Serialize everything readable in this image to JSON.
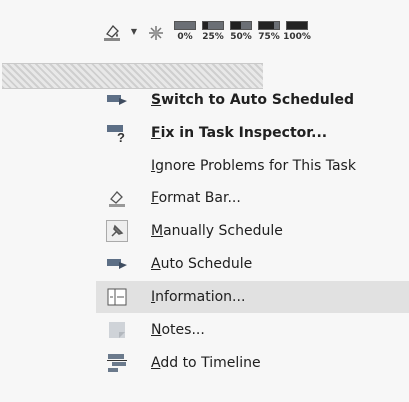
{
  "toolbar": {
    "tools": [
      {
        "name": "highlight-color-icon"
      },
      {
        "name": "dropdown-arrow-icon"
      },
      {
        "name": "task-status-icon"
      }
    ],
    "percent_buttons": [
      {
        "label": "0%",
        "value": 0
      },
      {
        "label": "25%",
        "value": 25
      },
      {
        "label": "50%",
        "value": 50
      },
      {
        "label": "75%",
        "value": 75
      },
      {
        "label": "100%",
        "value": 100
      }
    ]
  },
  "menu": {
    "items": [
      {
        "label": "Switch to Auto Scheduled",
        "icon": "auto-schedule-icon",
        "bold": true
      },
      {
        "label": "Fix in Task Inspector...",
        "icon": "task-inspector-icon",
        "bold": true
      },
      {
        "label": "Ignore Problems for This Task",
        "icon": null,
        "bold": false
      },
      {
        "label": "Format Bar...",
        "icon": "format-bar-icon",
        "bold": false
      },
      {
        "label": "Manually Schedule",
        "icon": "pushpin-icon",
        "bold": false
      },
      {
        "label": "Auto Schedule",
        "icon": "auto-schedule-icon",
        "bold": false
      },
      {
        "label": "Information...",
        "icon": "information-icon",
        "bold": false,
        "highlighted": true
      },
      {
        "label": "Notes...",
        "icon": "notes-icon",
        "bold": false
      },
      {
        "label": "Add to Timeline",
        "icon": "timeline-icon",
        "bold": false
      }
    ]
  }
}
